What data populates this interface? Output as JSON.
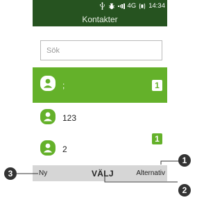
{
  "status_bar": {
    "usb_icon": "usb-icon",
    "bug_icon": "bug-icon",
    "signal_icon": "signal-icon",
    "network": "4G",
    "battery_icon": "battery-icon",
    "time": "14:34"
  },
  "header": {
    "title": "Kontakter"
  },
  "search": {
    "placeholder": "Sök"
  },
  "contacts": [
    {
      "name": ";",
      "badge": "1",
      "selected": true
    },
    {
      "name": "123",
      "badge": "",
      "selected": false
    },
    {
      "name": "2",
      "badge": "1",
      "selected": false
    }
  ],
  "softkeys": {
    "left": "Ny",
    "center": "VÄLJ",
    "right": "Alternativ"
  },
  "callouts": {
    "one": "1",
    "two": "2",
    "three": "3"
  },
  "colors": {
    "header": "#265320",
    "accent": "#64b12a",
    "softkey_bar": "#d6d6d6"
  }
}
